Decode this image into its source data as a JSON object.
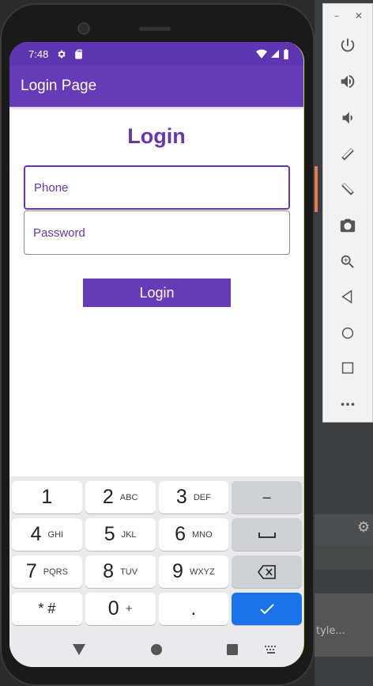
{
  "status_bar": {
    "time": "7:48"
  },
  "app_bar": {
    "title": "Login Page"
  },
  "login": {
    "heading": "Login",
    "phone_placeholder": "Phone",
    "password_placeholder": "Password",
    "submit_label": "Login"
  },
  "keyboard": {
    "rows": [
      [
        {
          "num": "1",
          "letters": ""
        },
        {
          "num": "2",
          "letters": "ABC"
        },
        {
          "num": "3",
          "letters": "DEF"
        },
        {
          "sym": "–"
        }
      ],
      [
        {
          "num": "4",
          "letters": "GHI"
        },
        {
          "num": "5",
          "letters": "JKL"
        },
        {
          "num": "6",
          "letters": "MNO"
        },
        {
          "sym": "␣"
        }
      ],
      [
        {
          "num": "7",
          "letters": "PQRS"
        },
        {
          "num": "8",
          "letters": "TUV"
        },
        {
          "num": "9",
          "letters": "WXYZ"
        },
        {
          "sym": "⌫"
        }
      ],
      [
        {
          "sym": "* #"
        },
        {
          "num": "0",
          "letters": "+"
        },
        {
          "sym": "."
        },
        {
          "sym": "✓"
        }
      ]
    ]
  },
  "ide": {
    "partial_text": "tyle..."
  },
  "colors": {
    "primary": "#673ab7",
    "status": "#5e35b1",
    "accent_text": "#6a35b4",
    "enter": "#1a73e8"
  }
}
